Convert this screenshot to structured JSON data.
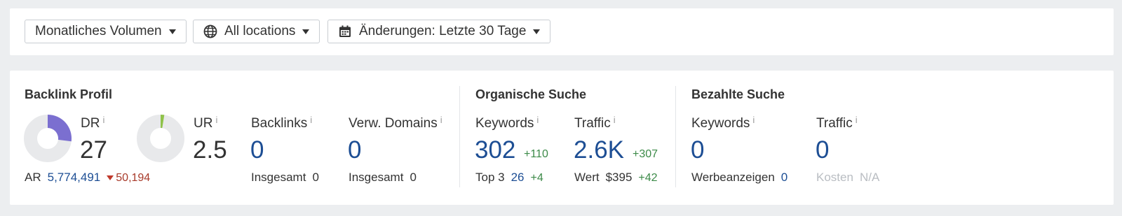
{
  "filters": {
    "volume_label": "Monatliches Volumen",
    "locations_label": "All locations",
    "changes_label": "Änderungen: Letzte 30 Tage"
  },
  "backlink": {
    "title": "Backlink Profil",
    "dr": {
      "label": "DR",
      "info": "i",
      "value": "27",
      "gauge_fraction": 0.27
    },
    "ur": {
      "label": "UR",
      "info": "i",
      "value": "2.5",
      "gauge_fraction": 0.025
    },
    "ar": {
      "label": "AR",
      "value": "5,774,491",
      "delta": "50,194"
    },
    "backlinks": {
      "label": "Backlinks",
      "info": "i",
      "value": "0",
      "sub_label": "Insgesamt",
      "sub_value": "0"
    },
    "domains": {
      "label": "Verw. Domains",
      "info": "i",
      "value": "0",
      "sub_label": "Insgesamt",
      "sub_value": "0"
    }
  },
  "organic": {
    "title": "Organische Suche",
    "keywords": {
      "label": "Keywords",
      "info": "i",
      "value": "302",
      "delta": "+110",
      "sub_label": "Top 3",
      "sub_value": "26",
      "sub_delta": "+4"
    },
    "traffic": {
      "label": "Traffic",
      "info": "i",
      "value": "2.6K",
      "delta": "+307",
      "sub_label": "Wert",
      "sub_value": "$395",
      "sub_delta": "+42"
    }
  },
  "paid": {
    "title": "Bezahlte Suche",
    "keywords": {
      "label": "Keywords",
      "info": "i",
      "value": "0",
      "sub_label": "Werbeanzeigen",
      "sub_value": "0"
    },
    "traffic": {
      "label": "Traffic",
      "info": "i",
      "value": "0",
      "sub_label": "Kosten",
      "sub_value": "N/A"
    }
  },
  "colors": {
    "dr_gauge": "#7b6fd0",
    "ur_gauge": "#8fc24a",
    "gauge_track": "#e8e9eb",
    "link_blue": "#1d4e94",
    "positive": "#3c8a48",
    "negative": "#c0392b"
  },
  "icons": [
    "caret-down-icon",
    "globe-icon",
    "calendar-icon",
    "info-icon",
    "triangle-down-icon"
  ]
}
